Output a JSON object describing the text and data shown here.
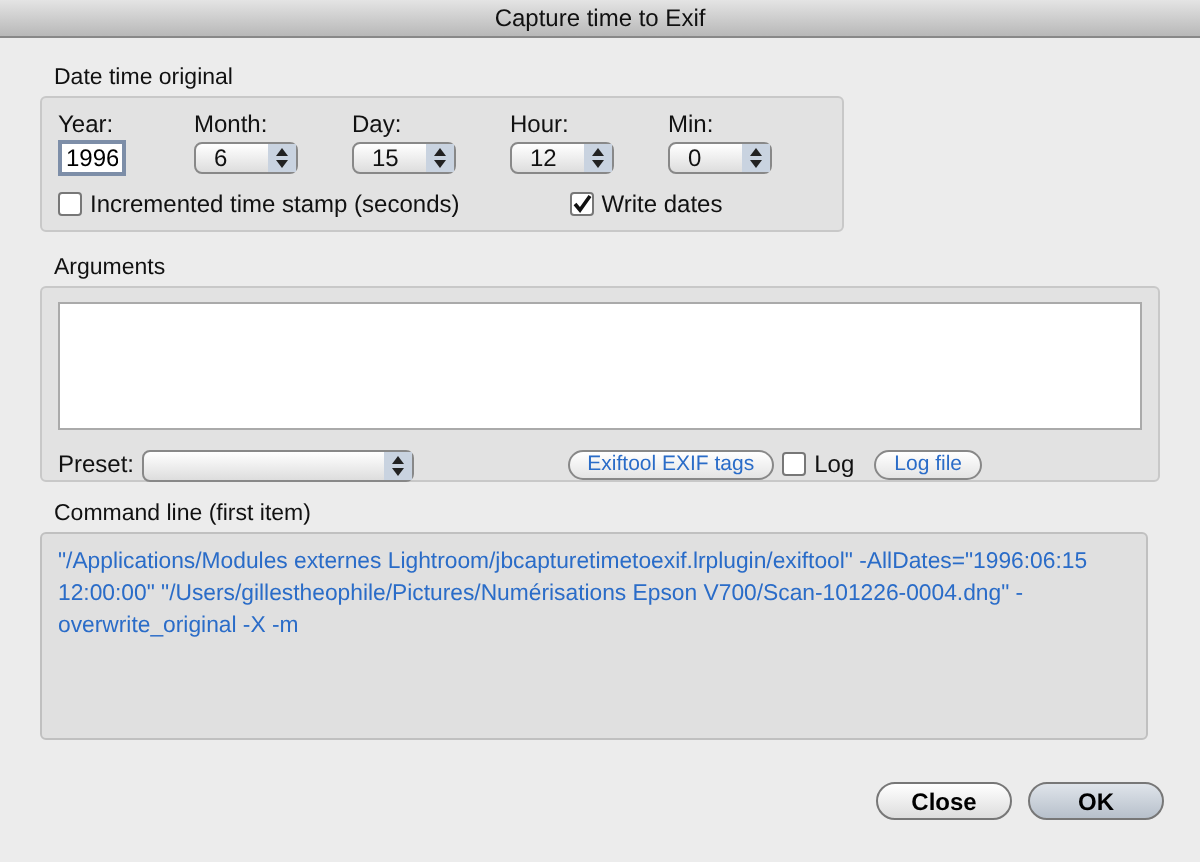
{
  "window": {
    "title": "Capture time to Exif"
  },
  "date_group": {
    "title": "Date time original",
    "year": {
      "label": "Year:",
      "value": "1996"
    },
    "popups": [
      {
        "label": "Month:",
        "value": "6"
      },
      {
        "label": "Day:",
        "value": "15"
      },
      {
        "label": "Hour:",
        "value": "12"
      },
      {
        "label": "Min:",
        "value": "0"
      }
    ],
    "increment": {
      "label": "Incremented time stamp (seconds)",
      "checked": false
    },
    "write_dates": {
      "label": "Write dates",
      "checked": true
    }
  },
  "arguments": {
    "title": "Arguments",
    "preset_label": "Preset:",
    "tags_button": "Exiftool EXIF tags",
    "log": {
      "label": "Log",
      "checked": false
    },
    "log_file_button": "Log file"
  },
  "command_line": {
    "title": "Command line (first item)",
    "text": "\"/Applications/Modules externes Lightroom/jbcapturetimetoexif.lrplugin/exiftool\" -AllDates=\"1996:06:15 12:00:00\"     \"/Users/gillestheophile/Pictures/Numérisations Epson V700/Scan-101226-0004.dng\" -overwrite_original -X -m"
  },
  "buttons": [
    {
      "label": "Close",
      "default": false
    },
    {
      "label": "OK",
      "default": true
    }
  ]
}
